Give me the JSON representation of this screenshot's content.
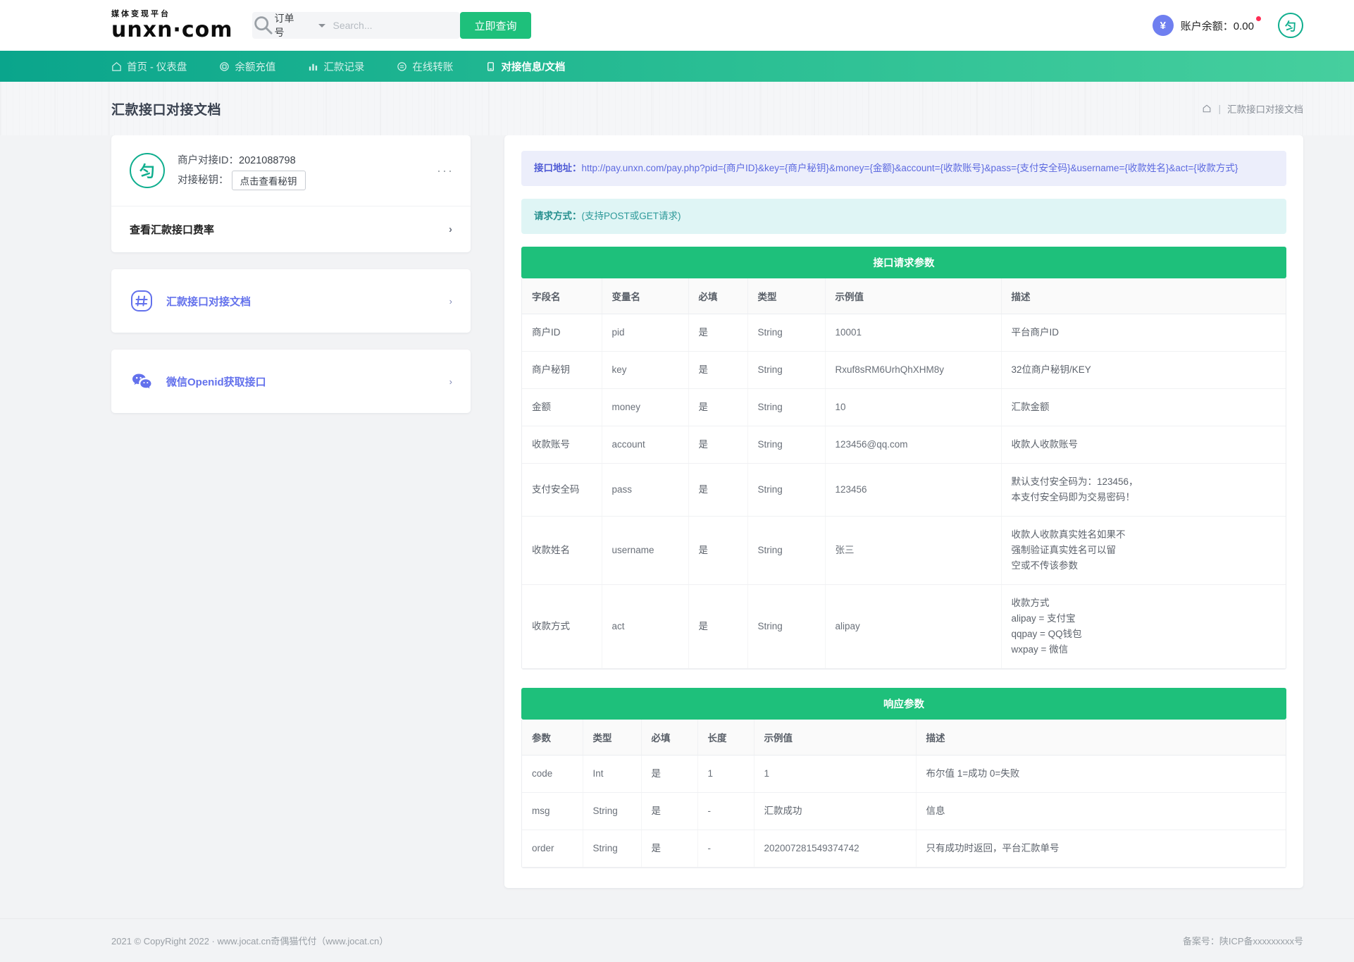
{
  "header": {
    "brand_sub": "媒体变现平台",
    "brand_main": "unxn·com",
    "search": {
      "category": "订单号",
      "placeholder": "Search...",
      "value": "",
      "button": "立即查询"
    },
    "balance_label": "账户余额：",
    "balance_value": "0.00",
    "avatar_glyph": "匀"
  },
  "nav": {
    "items": [
      {
        "label": "首页 - 仪表盘",
        "icon": "home-icon",
        "active": false
      },
      {
        "label": "余额充值",
        "icon": "wallet-icon",
        "active": false
      },
      {
        "label": "汇款记录",
        "icon": "chart-bar-icon",
        "active": false
      },
      {
        "label": "在线转账",
        "icon": "transfer-icon",
        "active": false
      },
      {
        "label": "对接信息/文档",
        "icon": "document-icon",
        "active": true
      }
    ]
  },
  "page": {
    "title": "汇款接口对接文档",
    "breadcrumb": {
      "home_icon": "home-icon",
      "separator": "|",
      "current": "汇款接口对接文档"
    }
  },
  "sidebar": {
    "merchant": {
      "logo_glyph": "匀",
      "id_label": "商户对接ID：",
      "id_value": "2021088798",
      "key_label": "对接秘钥：",
      "key_button": "点击查看秘钥",
      "more": "···"
    },
    "rate_row": {
      "label": "查看汇款接口费率",
      "arrow": "›"
    },
    "links": [
      {
        "label": "汇款接口对接文档",
        "icon": "hashtag-badge-icon",
        "arrow": "›"
      },
      {
        "label": "微信Openid获取接口",
        "icon": "wechat-icon",
        "arrow": "›"
      }
    ]
  },
  "main": {
    "endpoint": {
      "label": "接口地址：",
      "url": "http://pay.unxn.com/pay.php?pid={商户ID}&key={商户秘钥}&money={金额}&account={收款账号}&pass={支付安全码}&username={收款姓名}&act={收款方式}"
    },
    "method": {
      "label": "请求方式：",
      "value": "(支持POST或GET请求)"
    },
    "request_section_title": "接口请求参数",
    "request_table": {
      "columns": [
        "字段名",
        "变量名",
        "必填",
        "类型",
        "示例值",
        "描述"
      ],
      "rows": [
        [
          "商户ID",
          "pid",
          "是",
          "String",
          "10001",
          "平台商户ID"
        ],
        [
          "商户秘钥",
          "key",
          "是",
          "String",
          "Rxuf8sRM6UrhQhXHM8y",
          "32位商户秘钥/KEY"
        ],
        [
          "金额",
          "money",
          "是",
          "String",
          "10",
          "汇款金额"
        ],
        [
          "收款账号",
          "account",
          "是",
          "String",
          "123456@qq.com",
          "收款人收款账号"
        ],
        [
          "支付安全码",
          "pass",
          "是",
          "String",
          "123456",
          "默认支付安全码为：123456，\n本支付安全码即为交易密码！"
        ],
        [
          "收款姓名",
          "username",
          "是",
          "String",
          "张三",
          "收款人收款真实姓名如果不\n强制验证真实姓名可以留\n空或不传该参数"
        ],
        [
          "收款方式",
          "act",
          "是",
          "String",
          "alipay",
          "收款方式\nalipay = 支付宝\nqqpay = QQ钱包\nwxpay = 微信"
        ]
      ]
    },
    "response_section_title": "响应参数",
    "response_table": {
      "columns": [
        "参数",
        "类型",
        "必填",
        "长度",
        "示例值",
        "描述"
      ],
      "rows": [
        [
          "code",
          "Int",
          "是",
          "1",
          "1",
          "布尔值 1=成功 0=失败"
        ],
        [
          "msg",
          "String",
          "是",
          "-",
          "汇款成功",
          "信息"
        ],
        [
          "order",
          "String",
          "是",
          "-",
          "202007281549374742",
          "只有成功时返回，平台汇款单号"
        ]
      ]
    }
  },
  "footer": {
    "left": "2021 © CopyRight 2022 · www.jocat.cn奇偶猫代付（www.jocat.cn）",
    "right": "备案号：陕ICP备xxxxxxxxx号"
  },
  "colors": {
    "brand_green": "#1ec07b",
    "nav_green": "#2bbf94",
    "accent_purple": "#6371ec",
    "badge_red": "#ff2d55"
  }
}
